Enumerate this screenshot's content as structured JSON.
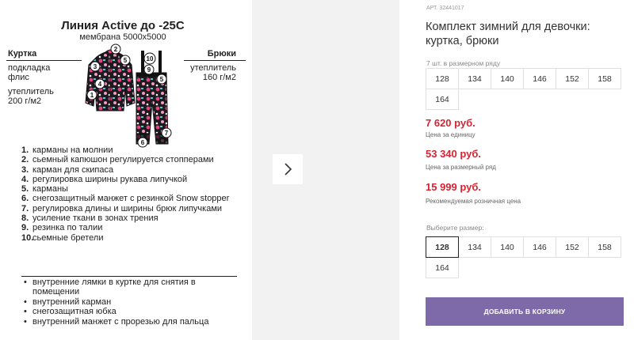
{
  "product_image": {
    "title": "Линия Active до -25С",
    "subtitle": "мембрана 5000х5000",
    "jacket": {
      "heading": "Куртка",
      "lines": [
        "подкладка",
        "флис",
        "утеплитель",
        "200 г/м2"
      ]
    },
    "pants": {
      "heading": "Брюки",
      "lines": [
        "утеплитель",
        "160 г/м2"
      ]
    },
    "callouts": [
      "1",
      "2",
      "3",
      "4",
      "5",
      "6",
      "7",
      "8",
      "9",
      "10"
    ],
    "features": [
      {
        "num": "1.",
        "text": "карманы на молнии"
      },
      {
        "num": "2.",
        "text": "сьемный капюшон регулируется стопперами"
      },
      {
        "num": "3.",
        "text": "карман для скипаса"
      },
      {
        "num": "4.",
        "text": "регулировка ширины рукава липучкой"
      },
      {
        "num": "5.",
        "text": "карманы"
      },
      {
        "num": "6.",
        "text": "снегозащитный манжет с резинкой Snow stopper"
      },
      {
        "num": "7.",
        "text": "регулировка длины и ширины брюк липучками"
      },
      {
        "num": "8.",
        "text": "усиление ткани в зонах трения"
      },
      {
        "num": "9.",
        "text": "резинка по талии"
      },
      {
        "num": "10.",
        "text": "сьемные бретели"
      }
    ],
    "extras": [
      "внутренние лямки в куртке для снятия в помещении",
      "внутренний карман",
      "снегозащитная юбка",
      "внутренний манжет с прорезью для пальца"
    ]
  },
  "gallery": {
    "next_icon": "chevron-right-icon"
  },
  "product": {
    "art_label": "АРТ.",
    "art_number": "32441017",
    "title": "Комплект зимний для девочки: куртка, брюки",
    "size_row_label": "7 шт. в размерном ряду",
    "sizes": [
      "128",
      "134",
      "140",
      "146",
      "152",
      "158",
      "164"
    ],
    "price_unit": "7 620 руб.",
    "price_unit_label": "Цена за единицу",
    "price_row": "53 340 руб.",
    "price_row_label": "Цена за размерный ряд",
    "price_retail": "15 999 руб.",
    "price_retail_label": "Рекомендуемая розничная цена",
    "choose_size_label": "Выберите размер:",
    "selected_size": "128",
    "add_to_cart": "ДОБАВИТЬ В КОРЗИНУ"
  },
  "colors": {
    "accent_button": "#7e6aa9",
    "price": "#d62332",
    "panel": "#f2f2f2"
  }
}
